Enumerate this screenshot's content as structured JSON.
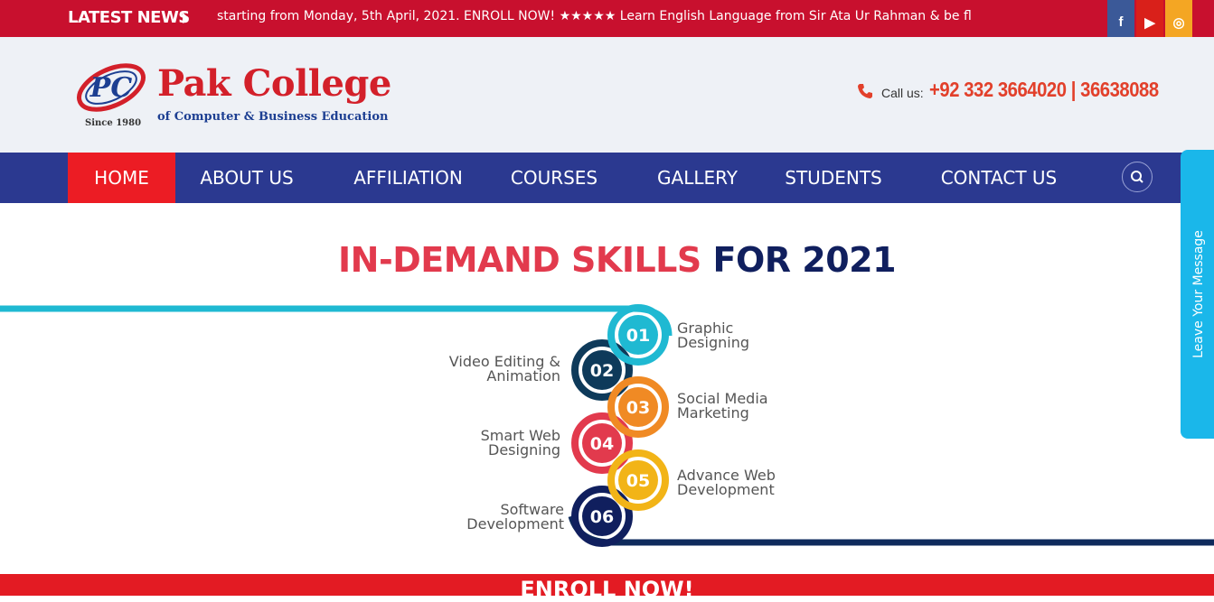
{
  "news": {
    "label": "LATEST NEWS",
    "ticker": "starting from Monday, 5th April, 2021. ENROLL NOW!  ★★★★★  Learn English Language from Sir Ata Ur Rahman & be fluent in ju"
  },
  "social": {
    "facebook": "f",
    "youtube": "▶",
    "instagram": "◎"
  },
  "header": {
    "logo_monogram": "PC",
    "title": "Pak College",
    "subtitle": "of Computer & Business Education",
    "since": "Since 1980",
    "call_label": "Call us:",
    "phone": "+92 332 3664020 | 36638088"
  },
  "nav": {
    "items": [
      "HOME",
      "ABOUT US",
      "AFFILIATION",
      "COURSES",
      "GALLERY",
      "STUDENTS",
      "CONTACT US"
    ]
  },
  "leave_message": "Leave Your Message",
  "banner": {
    "title_red": "IN-DEMAND SKILLS ",
    "title_navy": "FOR 2021",
    "skills": [
      {
        "num": "01",
        "line1": "Graphic",
        "line2": "Designing"
      },
      {
        "num": "02",
        "line1": "Video Editing &",
        "line2": "Animation"
      },
      {
        "num": "03",
        "line1": "Social Media",
        "line2": "Marketing"
      },
      {
        "num": "04",
        "line1": "Smart Web",
        "line2": "Designing"
      },
      {
        "num": "05",
        "line1": "Advance Web",
        "line2": "Development"
      },
      {
        "num": "06",
        "line1": "Software",
        "line2": "Development"
      }
    ],
    "enroll": "ENROLL NOW!"
  },
  "colors": {
    "news_red": "#c8102e",
    "nav_blue": "#2b3990",
    "nav_active": "#ec1c24",
    "cyan": "#1fb9d2",
    "navy": "#0e2a5c",
    "orange": "#f08a24",
    "red": "#e23a4d",
    "gold": "#f2b417",
    "darkblue": "#101f5e"
  }
}
